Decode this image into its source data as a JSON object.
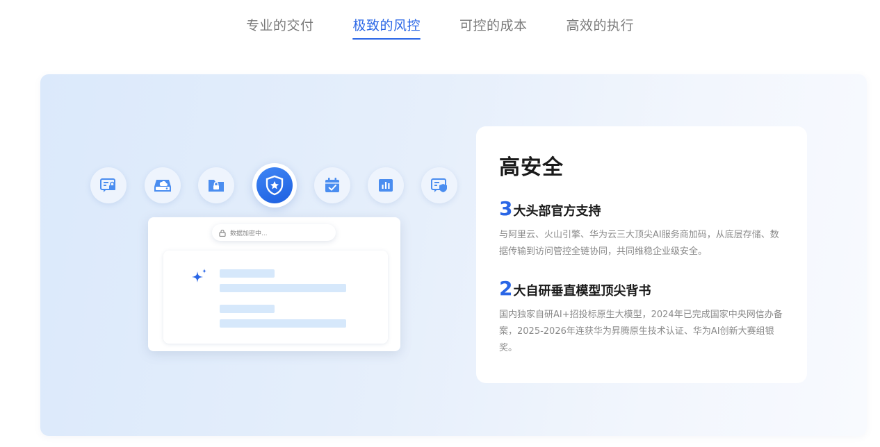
{
  "tabs": [
    {
      "label": "专业的交付",
      "active": false
    },
    {
      "label": "极致的风控",
      "active": true
    },
    {
      "label": "可控的成本",
      "active": false
    },
    {
      "label": "高效的执行",
      "active": false
    }
  ],
  "mock": {
    "search_text": "数据加密中..."
  },
  "info": {
    "title": "高安全",
    "features": [
      {
        "num": "3",
        "title": "大头部官方支持",
        "desc": "与阿里云、火山引擎、华为云三大顶尖AI服务商加码，从底层存储、数据传输到访问管控全链协同，共同维稳企业级安全。"
      },
      {
        "num": "2",
        "title": "大自研垂直模型顶尖背书",
        "desc": "国内独家自研AI+招投标原生大模型，2024年已完成国家中央网信办备案，2025-2026年连获华为昇腾原生技术认证、华为AI创新大赛组银奖。"
      }
    ]
  },
  "colors": {
    "accent": "#2a66e6",
    "icon_blue": "#4a8df0"
  }
}
